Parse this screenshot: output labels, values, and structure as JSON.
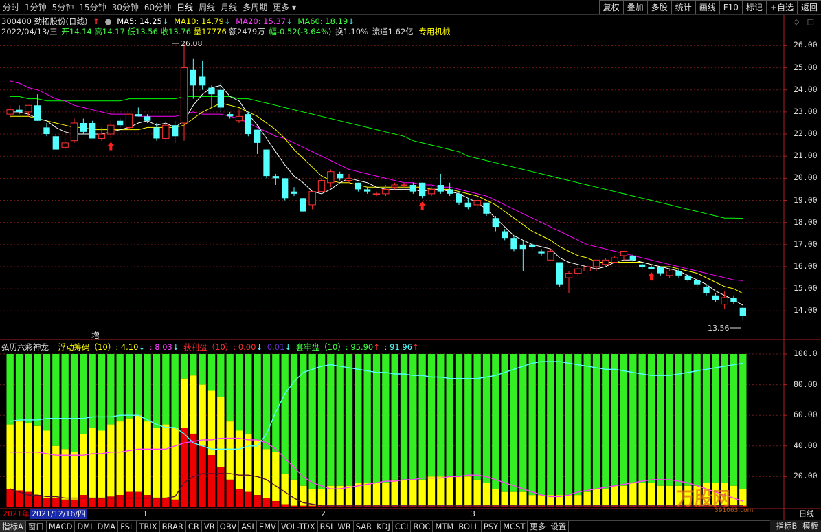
{
  "toolbar": {
    "periods": [
      "分时",
      "1分钟",
      "5分钟",
      "15分钟",
      "30分钟",
      "60分钟",
      "日线",
      "周线",
      "月线",
      "多周期",
      "更多"
    ],
    "active_period": "日线",
    "right_buttons": [
      "复权",
      "叠加",
      "多股",
      "统计",
      "画线",
      "F10",
      "标记",
      "+自选",
      "返回"
    ]
  },
  "stock": {
    "code": "300400",
    "name": "劲拓股份(日线)",
    "ma5": "MA5: 14.25",
    "ma10": "MA10: 14.79",
    "ma20": "MA20: 15.37",
    "ma60": "MA60: 18.19",
    "date": "2022/04/13/三",
    "open": "开14.14",
    "high": "高14.17",
    "low": "低13.56",
    "close": "收13.76",
    "volume": "量17776",
    "amount": "额2479万",
    "change": "幅-0.52(-3.64%)",
    "turnover": "换1.10%",
    "float": "流通1.62亿",
    "sector": "专用机械",
    "max_label": "26.08",
    "min_label": "13.56",
    "zeng_label": "增"
  },
  "indicator": {
    "title": "弘历六彩神龙",
    "float_chip": "浮动筹码（10）: 4.10",
    "float_chip2": ": 8.03",
    "profit": "获利盘（10）: 0.00",
    "profit2": "0.01",
    "trapped": "套牢盘（10）: 95.90",
    "trapped2": ": 91.96"
  },
  "dates": {
    "year": "2021年",
    "date": "2021/12/16/四",
    "months": [
      "1",
      "2",
      "3"
    ],
    "right": "日线"
  },
  "bottom_tabs": [
    "指标A",
    "窗口",
    "MACD",
    "DMI",
    "DMA",
    "FSL",
    "TRIX",
    "BRAR",
    "CR",
    "VR",
    "OBV",
    "ASI",
    "EMV",
    "VOL-TDX",
    "RSI",
    "WR",
    "SAR",
    "KDJ",
    "CCI",
    "ROC",
    "MTM",
    "BOLL",
    "PSY",
    "MCST",
    "更多",
    "设置"
  ],
  "bottom_right": [
    "指标B",
    "模板"
  ],
  "watermark": "万股网",
  "watermark_sub": "391063.com",
  "colors": {
    "up": "#ff3232",
    "down": "#54ffff",
    "ma5": "#ffffff",
    "ma10": "#ffff00",
    "ma20": "#ff00ff",
    "ma60": "#00ff00",
    "green_bar": "#33ee22",
    "yellow_bar": "#ffff00",
    "red_bar": "#ee0000"
  },
  "chart_data": {
    "type": "candlestick",
    "y_ticks": [
      26.0,
      25.0,
      24.0,
      23.0,
      22.0,
      21.0,
      20.0,
      19.0,
      18.0,
      17.0,
      16.0,
      15.0,
      14.0
    ],
    "ind_ticks": [
      "100.0",
      "80.00",
      "60.00",
      "40.00",
      "20.00"
    ],
    "ylim": [
      13.2,
      26.2
    ],
    "candles": [
      [
        22.9,
        23.3,
        22.7,
        23.1
      ],
      [
        23.1,
        23.3,
        22.9,
        23.0
      ],
      [
        23.0,
        23.3,
        22.8,
        23.3
      ],
      [
        23.3,
        23.8,
        22.6,
        22.6
      ],
      [
        22.3,
        22.5,
        21.9,
        22.0
      ],
      [
        21.9,
        22.0,
        21.3,
        21.3
      ],
      [
        21.4,
        21.8,
        21.3,
        21.6
      ],
      [
        21.7,
        22.7,
        21.6,
        22.5
      ],
      [
        22.5,
        22.7,
        22.0,
        22.1
      ],
      [
        22.5,
        22.6,
        21.8,
        21.8
      ],
      [
        21.8,
        22.3,
        21.7,
        22.0
      ],
      [
        22.0,
        22.6,
        21.8,
        22.4
      ],
      [
        22.6,
        22.7,
        22.3,
        22.4
      ],
      [
        22.3,
        22.9,
        22.2,
        22.9
      ],
      [
        22.9,
        23.2,
        22.8,
        22.8
      ],
      [
        22.8,
        22.9,
        22.5,
        22.6
      ],
      [
        22.3,
        22.5,
        21.7,
        21.8
      ],
      [
        21.8,
        22.6,
        21.6,
        22.4
      ],
      [
        22.4,
        22.6,
        21.6,
        21.9
      ],
      [
        22.5,
        26.08,
        21.7,
        25.0
      ],
      [
        24.9,
        25.4,
        23.6,
        24.2
      ],
      [
        24.6,
        25.3,
        24.0,
        24.2
      ],
      [
        24.1,
        24.2,
        23.2,
        23.8
      ],
      [
        24.0,
        24.3,
        23.0,
        23.2
      ],
      [
        22.9,
        23.0,
        22.7,
        22.8
      ],
      [
        22.6,
        23.1,
        22.5,
        22.8
      ],
      [
        22.9,
        23.0,
        21.9,
        22.0
      ],
      [
        22.2,
        22.2,
        21.1,
        21.6
      ],
      [
        21.3,
        21.3,
        20.0,
        20.1
      ],
      [
        20.1,
        20.2,
        19.7,
        20.0
      ],
      [
        20.0,
        20.0,
        19.0,
        19.1
      ],
      [
        19.4,
        19.6,
        19.2,
        19.3
      ],
      [
        19.1,
        19.1,
        18.5,
        18.5
      ],
      [
        18.8,
        19.2,
        18.6,
        19.4
      ],
      [
        19.4,
        20.0,
        19.5,
        19.9
      ],
      [
        19.8,
        20.4,
        19.6,
        20.3
      ],
      [
        20.2,
        20.3,
        19.9,
        20.0
      ],
      [
        19.9,
        20.2,
        19.8,
        20.0
      ],
      [
        19.8,
        19.8,
        19.4,
        19.5
      ],
      [
        19.5,
        19.6,
        19.3,
        19.4
      ],
      [
        19.3,
        19.4,
        19.2,
        19.3
      ],
      [
        19.3,
        19.7,
        19.2,
        19.5
      ],
      [
        19.6,
        19.8,
        19.5,
        19.7
      ],
      [
        19.7,
        19.8,
        19.6,
        19.7
      ],
      [
        19.7,
        19.8,
        19.3,
        19.4
      ],
      [
        19.8,
        19.8,
        19.1,
        19.2
      ],
      [
        19.3,
        19.6,
        19.2,
        19.5
      ],
      [
        19.7,
        20.2,
        19.3,
        19.4
      ],
      [
        19.5,
        19.8,
        19.2,
        19.3
      ],
      [
        19.3,
        19.4,
        18.8,
        18.9
      ],
      [
        18.9,
        19.1,
        18.6,
        18.7
      ],
      [
        18.8,
        19.2,
        18.6,
        19.0
      ],
      [
        18.9,
        18.9,
        18.3,
        18.4
      ],
      [
        18.2,
        18.3,
        17.6,
        17.8
      ],
      [
        17.6,
        17.7,
        17.2,
        17.3
      ],
      [
        17.3,
        17.4,
        16.7,
        16.8
      ],
      [
        17.0,
        17.2,
        15.8,
        16.8
      ],
      [
        17.0,
        17.1,
        16.8,
        16.9
      ],
      [
        16.7,
        16.8,
        16.5,
        16.6
      ],
      [
        16.3,
        16.8,
        16.3,
        16.7
      ],
      [
        16.2,
        16.2,
        15.1,
        15.2
      ],
      [
        15.5,
        15.8,
        14.8,
        15.7
      ],
      [
        15.7,
        16.2,
        15.6,
        15.9
      ],
      [
        15.8,
        16.1,
        15.7,
        16.0
      ],
      [
        16.0,
        16.3,
        15.8,
        16.3
      ],
      [
        16.1,
        16.4,
        16.0,
        16.3
      ],
      [
        16.2,
        16.5,
        16.2,
        16.4
      ],
      [
        16.5,
        16.7,
        16.3,
        16.7
      ],
      [
        16.5,
        16.6,
        16.2,
        16.3
      ],
      [
        16.1,
        16.2,
        15.9,
        16.0
      ],
      [
        16.0,
        16.1,
        15.9,
        15.9
      ],
      [
        16.0,
        16.0,
        15.6,
        15.7
      ],
      [
        15.6,
        15.9,
        15.5,
        15.8
      ],
      [
        15.8,
        15.9,
        15.5,
        15.6
      ],
      [
        15.6,
        15.6,
        15.3,
        15.4
      ],
      [
        15.4,
        15.5,
        15.1,
        15.2
      ],
      [
        15.1,
        15.2,
        14.7,
        14.8
      ],
      [
        14.7,
        14.8,
        14.4,
        14.5
      ],
      [
        14.3,
        14.9,
        14.1,
        14.6
      ],
      [
        14.6,
        14.7,
        14.3,
        14.4
      ],
      [
        14.14,
        14.17,
        13.56,
        13.76
      ]
    ],
    "ma5": [
      23.0,
      23.0,
      22.9,
      22.7,
      22.6,
      22.3,
      22.1,
      22.0,
      22.0,
      22.0,
      22.0,
      22.1,
      22.2,
      22.3,
      22.5,
      22.6,
      22.4,
      22.5,
      22.3,
      22.6,
      23.3,
      23.8,
      24.1,
      24.2,
      23.7,
      23.5,
      22.9,
      22.4,
      21.8,
      21.2,
      20.6,
      20.1,
      19.8,
      19.4,
      19.3,
      19.5,
      19.8,
      20.0,
      19.9,
      19.8,
      19.6,
      19.5,
      19.5,
      19.5,
      19.5,
      19.4,
      19.5,
      19.5,
      19.4,
      19.3,
      19.1,
      18.9,
      18.6,
      18.2,
      17.8,
      17.4,
      17.2,
      17.0,
      16.9,
      16.8,
      16.4,
      16.2,
      16.1,
      16.0,
      15.9,
      16.0,
      16.2,
      16.3,
      16.3,
      16.2,
      16.1,
      16.0,
      15.9,
      15.8,
      15.6,
      15.4,
      15.2,
      14.9,
      14.7,
      14.5,
      14.25
    ],
    "ma10": [
      22.8,
      22.8,
      22.8,
      22.7,
      22.6,
      22.5,
      22.4,
      22.3,
      22.3,
      22.2,
      22.2,
      22.2,
      22.2,
      22.2,
      22.2,
      22.3,
      22.3,
      22.3,
      22.3,
      22.4,
      22.7,
      23.0,
      23.2,
      23.4,
      23.3,
      23.2,
      23.0,
      22.8,
      22.5,
      22.2,
      21.8,
      21.3,
      20.9,
      20.5,
      20.1,
      19.9,
      19.8,
      19.8,
      19.7,
      19.6,
      19.6,
      19.6,
      19.6,
      19.6,
      19.6,
      19.6,
      19.5,
      19.5,
      19.5,
      19.4,
      19.3,
      19.2,
      19.0,
      18.8,
      18.5,
      18.2,
      17.9,
      17.6,
      17.4,
      17.2,
      16.9,
      16.7,
      16.5,
      16.4,
      16.2,
      16.2,
      16.2,
      16.2,
      16.2,
      16.2,
      16.1,
      16.0,
      16.0,
      15.9,
      15.8,
      15.7,
      15.5,
      15.3,
      15.1,
      15.0,
      14.79
    ],
    "ma20": [
      24.4,
      24.3,
      24.1,
      24.0,
      23.8,
      23.6,
      23.5,
      23.3,
      23.2,
      23.1,
      23.0,
      22.9,
      22.9,
      22.9,
      22.8,
      22.8,
      22.8,
      22.8,
      22.8,
      22.9,
      23.0,
      22.9,
      22.9,
      22.9,
      22.8,
      22.7,
      22.5,
      22.3,
      22.1,
      21.9,
      21.8,
      21.6,
      21.4,
      21.2,
      21.0,
      20.8,
      20.6,
      20.4,
      20.3,
      20.2,
      20.1,
      20.0,
      19.9,
      19.8,
      19.8,
      19.7,
      19.7,
      19.6,
      19.6,
      19.5,
      19.4,
      19.3,
      19.2,
      19.0,
      18.8,
      18.6,
      18.4,
      18.2,
      18.0,
      17.8,
      17.6,
      17.4,
      17.2,
      17.0,
      16.9,
      16.8,
      16.7,
      16.6,
      16.5,
      16.4,
      16.3,
      16.2,
      16.1,
      16.0,
      15.9,
      15.8,
      15.7,
      15.6,
      15.5,
      15.4,
      15.37
    ],
    "ma60": [
      23.7,
      23.7,
      23.6,
      23.6,
      23.5,
      23.5,
      23.5,
      23.5,
      23.5,
      23.5,
      23.5,
      23.5,
      23.5,
      23.6,
      23.6,
      23.6,
      23.6,
      23.6,
      23.6,
      23.7,
      23.7,
      23.7,
      23.7,
      23.7,
      23.7,
      23.6,
      23.6,
      23.5,
      23.4,
      23.3,
      23.2,
      23.1,
      23.0,
      22.9,
      22.8,
      22.7,
      22.6,
      22.5,
      22.4,
      22.3,
      22.2,
      22.1,
      22.0,
      21.9,
      21.7,
      21.6,
      21.5,
      21.4,
      21.3,
      21.2,
      21.0,
      20.9,
      20.8,
      20.7,
      20.6,
      20.5,
      20.4,
      20.3,
      20.2,
      20.1,
      20.0,
      19.9,
      19.8,
      19.7,
      19.6,
      19.5,
      19.4,
      19.3,
      19.2,
      19.1,
      19.0,
      18.9,
      18.8,
      18.7,
      18.6,
      18.5,
      18.4,
      18.3,
      18.2,
      18.2,
      18.19
    ],
    "indicator": {
      "green_top": [
        100,
        100,
        100,
        100,
        100,
        100,
        100,
        100,
        100,
        100,
        100,
        100,
        100,
        100,
        100,
        100,
        100,
        100,
        100,
        100,
        100,
        100,
        100,
        100,
        100,
        100,
        100,
        100,
        100,
        100,
        100,
        100,
        100,
        100,
        100,
        100,
        100,
        100,
        100,
        100,
        100,
        100,
        100,
        100,
        100,
        100,
        100,
        100,
        100,
        100,
        100,
        100,
        100,
        100,
        100,
        100,
        100,
        100,
        100,
        100,
        100,
        100,
        100,
        100,
        100,
        100,
        100,
        100,
        100,
        100,
        100,
        100,
        100,
        100,
        100,
        100,
        100,
        100,
        100,
        100,
        100
      ],
      "yellow": [
        54,
        56,
        55,
        53,
        50,
        40,
        38,
        36,
        48,
        52,
        50,
        54,
        56,
        58,
        60,
        56,
        52,
        54,
        52,
        84,
        86,
        80,
        76,
        72,
        56,
        50,
        48,
        44,
        38,
        36,
        22,
        18,
        14,
        12,
        12,
        14,
        14,
        14,
        16,
        16,
        16,
        16,
        18,
        18,
        18,
        18,
        20,
        20,
        20,
        20,
        20,
        18,
        16,
        12,
        10,
        10,
        10,
        8,
        8,
        8,
        8,
        8,
        8,
        10,
        12,
        12,
        14,
        14,
        16,
        16,
        16,
        14,
        14,
        14,
        14,
        14,
        16,
        16,
        16,
        14,
        12
      ],
      "red": [
        12,
        11,
        10,
        8,
        6,
        6,
        5,
        5,
        8,
        6,
        6,
        7,
        8,
        10,
        10,
        8,
        6,
        6,
        5,
        52,
        48,
        40,
        34,
        26,
        18,
        12,
        10,
        8,
        6,
        4,
        2,
        1,
        1,
        1,
        1,
        1,
        1,
        1,
        1,
        1,
        1,
        1,
        1,
        1,
        1,
        1,
        1,
        1,
        1,
        1,
        1,
        1,
        1,
        1,
        1,
        1,
        1,
        1,
        1,
        1,
        1,
        1,
        1,
        1,
        1,
        1,
        1,
        1,
        1,
        1,
        1,
        1,
        1,
        1,
        1,
        1,
        1,
        1,
        1,
        1,
        1
      ],
      "cyan_line": [
        56,
        57,
        57,
        57,
        58,
        58,
        58,
        58,
        58,
        59,
        59,
        59,
        60,
        60,
        60,
        57,
        54,
        52,
        52,
        48,
        42,
        40,
        38,
        38,
        38,
        38,
        40,
        40,
        48,
        62,
        74,
        82,
        88,
        90,
        92,
        93,
        92,
        91,
        90,
        89,
        88,
        88,
        87,
        87,
        86,
        86,
        85,
        85,
        84,
        84,
        84,
        84,
        85,
        86,
        88,
        90,
        92,
        94,
        95,
        95,
        95,
        94,
        93,
        92,
        91,
        90,
        90,
        89,
        88,
        87,
        86,
        86,
        86,
        87,
        88,
        89,
        90,
        91,
        92,
        93,
        94
      ],
      "magenta_line": [
        36,
        36,
        36,
        36,
        35,
        34,
        34,
        34,
        34,
        35,
        35,
        36,
        36,
        37,
        38,
        38,
        38,
        38,
        40,
        42,
        43,
        44,
        44,
        45,
        45,
        45,
        44,
        44,
        42,
        38,
        32,
        26,
        20,
        16,
        14,
        12,
        12,
        13,
        14,
        15,
        16,
        17,
        17,
        18,
        18,
        19,
        19,
        19,
        20,
        20,
        21,
        21,
        20,
        18,
        16,
        14,
        12,
        10,
        8,
        7,
        7,
        8,
        10,
        11,
        12,
        13,
        14,
        15,
        16,
        17,
        18,
        18,
        18,
        17,
        16,
        14,
        12,
        10,
        8,
        6,
        4
      ],
      "dark_line": [
        12,
        10,
        8,
        8,
        7,
        7,
        6,
        6,
        6,
        6,
        6,
        6,
        6,
        6,
        6,
        6,
        6,
        6,
        7,
        16,
        20,
        22,
        22,
        22,
        22,
        21,
        21,
        20,
        18,
        14,
        10,
        6,
        3,
        2,
        1,
        1,
        1,
        1,
        1,
        1,
        1,
        1,
        1,
        1,
        1,
        1,
        1,
        1,
        1,
        1,
        1,
        1,
        1,
        1,
        1,
        1,
        1,
        1,
        1,
        1,
        1,
        1,
        1,
        1,
        1,
        1,
        1,
        1,
        1,
        1,
        1,
        1,
        1,
        1,
        1,
        1,
        1,
        1,
        1,
        1,
        1
      ]
    }
  }
}
